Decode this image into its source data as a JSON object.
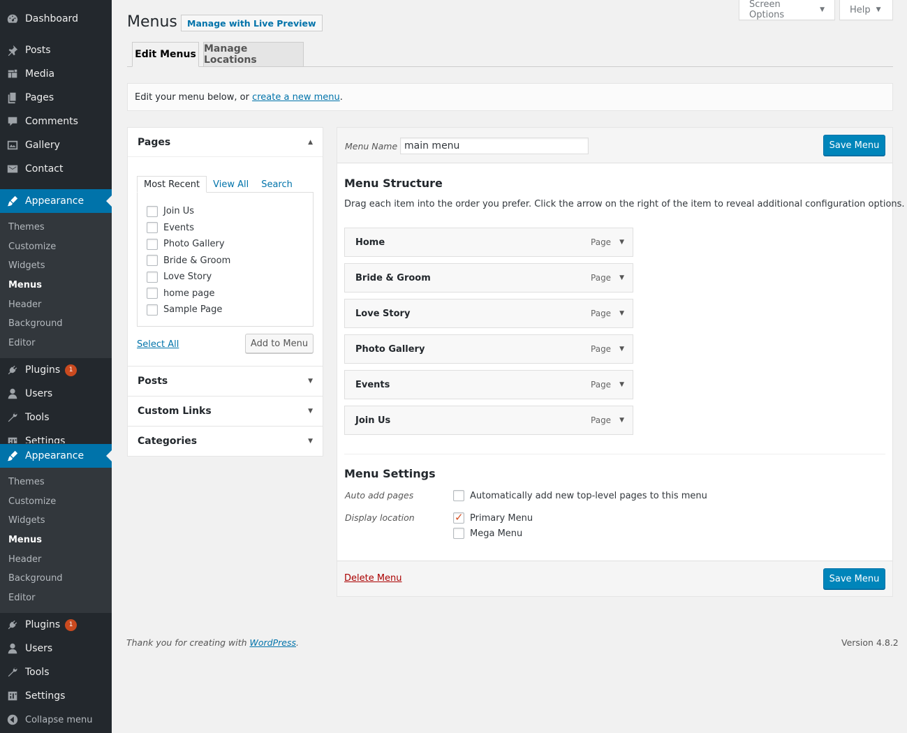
{
  "sidebar": {
    "top_items": [
      {
        "label": "Dashboard",
        "icon": "dashboard-icon"
      },
      {
        "label": "Posts",
        "icon": "pin-icon"
      },
      {
        "label": "Media",
        "icon": "media-icon"
      },
      {
        "label": "Pages",
        "icon": "pages-icon"
      },
      {
        "label": "Comments",
        "icon": "comment-icon"
      },
      {
        "label": "Gallery",
        "icon": "gallery-icon"
      },
      {
        "label": "Contact",
        "icon": "mail-icon"
      }
    ],
    "appearance": "Appearance",
    "sub_items": [
      "Themes",
      "Customize",
      "Widgets",
      "Menus",
      "Header",
      "Background",
      "Editor"
    ],
    "plugins": "Plugins",
    "plugins_badge": "1",
    "users": "Users",
    "tools": "Tools",
    "settings": "Settings",
    "collapse": "Collapse menu"
  },
  "top": {
    "screen_options": "Screen Options",
    "help": "Help"
  },
  "page": {
    "title": "Menus",
    "live_preview": "Manage with Live Preview",
    "tabs": [
      "Edit Menus",
      "Manage Locations"
    ],
    "notice_prefix": "Edit your menu below, or ",
    "notice_link": "create a new menu",
    "notice_suffix": "."
  },
  "left": {
    "pages_title": "Pages",
    "inner_tabs": [
      "Most Recent",
      "View All",
      "Search"
    ],
    "pages": [
      "Join Us",
      "Events",
      "Photo Gallery",
      "Bride & Groom",
      "Love Story",
      "home page",
      "Sample Page"
    ],
    "select_all": "Select All",
    "add_to_menu": "Add to Menu",
    "sections": [
      "Posts",
      "Custom Links",
      "Categories"
    ]
  },
  "menu": {
    "name_label": "Menu Name",
    "name_value": "main menu",
    "save": "Save Menu",
    "structure_title": "Menu Structure",
    "structure_desc": "Drag each item into the order you prefer. Click the arrow on the right of the item to reveal additional configuration options.",
    "items": [
      {
        "title": "Home",
        "type": "Page"
      },
      {
        "title": "Bride & Groom",
        "type": "Page"
      },
      {
        "title": "Love Story",
        "type": "Page"
      },
      {
        "title": "Photo Gallery",
        "type": "Page"
      },
      {
        "title": "Events",
        "type": "Page"
      },
      {
        "title": "Join Us",
        "type": "Page"
      }
    ],
    "settings_title": "Menu Settings",
    "auto_add_label": "Auto add pages",
    "auto_add_text": "Automatically add new top-level pages to this menu",
    "display_location_label": "Display location",
    "locations": [
      {
        "label": "Primary Menu",
        "checked": true
      },
      {
        "label": "Mega Menu",
        "checked": false
      }
    ],
    "delete": "Delete Menu"
  },
  "footer": {
    "thanks_prefix": "Thank you for creating with ",
    "thanks_link": "WordPress",
    "thanks_suffix": ".",
    "version": "Version 4.8.2"
  },
  "colors": {
    "sidebar_bg": "#23282d",
    "accent": "#0073aa",
    "primary_button": "#0085ba",
    "delete_link": "#a00"
  }
}
